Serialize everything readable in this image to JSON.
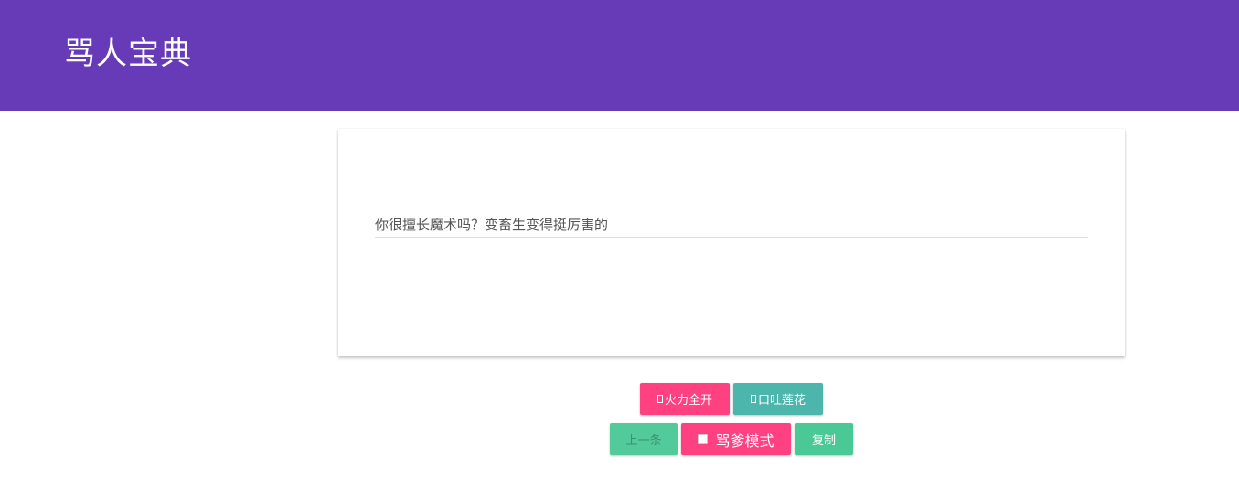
{
  "header": {
    "title": "骂人宝典",
    "background": "#673ab7"
  },
  "card": {
    "sentence": "你很擅长魔术吗？变畜生变得挺厉害的"
  },
  "buttons": {
    "fire_full": "火力全开",
    "lotus_mouth": "口吐莲花",
    "previous": "上一条",
    "scold_dad_mode": "骂爹模式",
    "copy": "复制"
  },
  "state": {
    "previous_disabled": true,
    "scold_dad_mode_checked": false
  },
  "colors": {
    "pink": "#ff4081",
    "teal": "#4db6ac",
    "green": "#4ac896"
  },
  "icons": {
    "fire_full": "missing-glyph-icon",
    "lotus_mouth": "missing-glyph-icon",
    "scold_dad_mode": "checkbox-icon"
  }
}
